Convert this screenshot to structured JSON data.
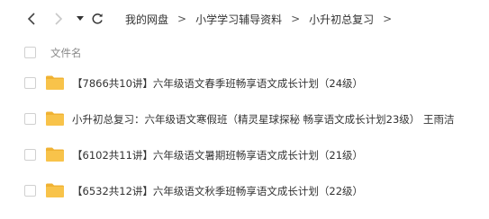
{
  "breadcrumb": [
    {
      "label": "我的网盘"
    },
    {
      "label": "小学学习辅导资料"
    },
    {
      "label": "小升初总复习"
    }
  ],
  "breadcrumb_separator": ">",
  "list": {
    "column_name": "文件名",
    "rows": [
      {
        "name": "【7866共10讲】六年级语文春季班畅享语文成长计划（24级）",
        "type": "folder"
      },
      {
        "name": "小升初总复习：六年级语文寒假班（精灵星球探秘 畅享语文成长计划23级） 王雨洁",
        "type": "folder"
      },
      {
        "name": "【6102共11讲】六年级语文暑期班畅享语文成长计划（21级）",
        "type": "folder"
      },
      {
        "name": "【6532共12讲】六年级语文秋季班畅享语文成长计划（22级）",
        "type": "folder"
      }
    ]
  },
  "icons": {
    "back": "chevron-left-icon",
    "forward": "chevron-right-icon",
    "dropdown": "caret-down-icon",
    "refresh": "refresh-icon",
    "folder": "folder-icon"
  },
  "colors": {
    "folder": "#f8c34a",
    "folder_back": "#f0b232",
    "text": "#333333",
    "muted": "#888888",
    "checkbox_border": "#d0d0d0"
  }
}
